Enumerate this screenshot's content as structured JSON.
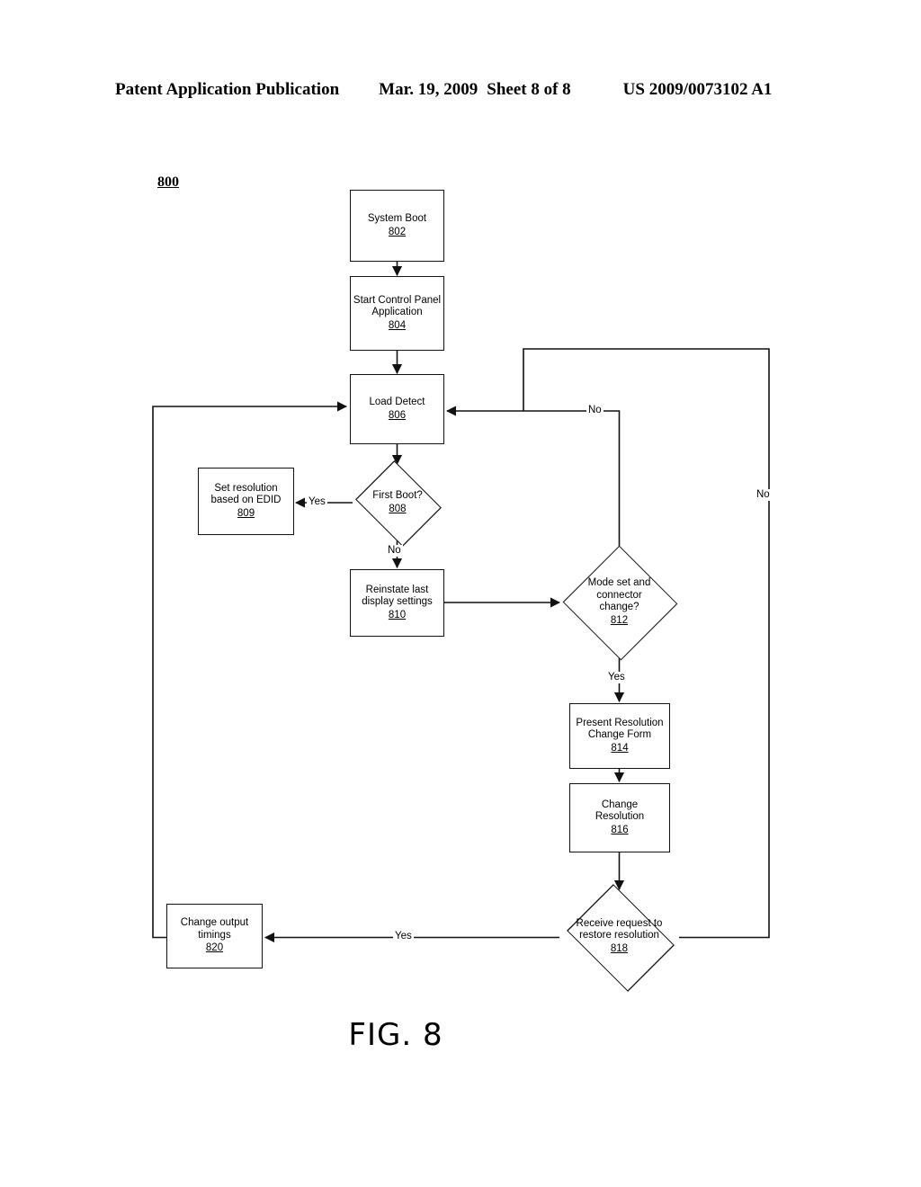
{
  "header": {
    "publication": "Patent Application Publication",
    "date": "Mar. 19, 2009",
    "sheet": "Sheet 8 of 8",
    "number": "US 2009/0073102 A1"
  },
  "figure": {
    "caption": "FIG. 8",
    "diagram_reference": "800"
  },
  "flowchart": {
    "nodes": [
      {
        "id": "802",
        "shape": "process",
        "text": "System Boot",
        "number": "802"
      },
      {
        "id": "804",
        "shape": "process",
        "text": "Start Control Panel\nApplication",
        "number": "804"
      },
      {
        "id": "806",
        "shape": "process",
        "text": "Load Detect",
        "number": "806"
      },
      {
        "id": "808",
        "shape": "decision",
        "text": "First Boot?",
        "number": "808"
      },
      {
        "id": "809",
        "shape": "process",
        "text": "Set resolution\nbased on EDID",
        "number": "809"
      },
      {
        "id": "810",
        "shape": "process",
        "text": "Reinstate last\ndisplay settings",
        "number": "810"
      },
      {
        "id": "812",
        "shape": "decision",
        "text": "Mode set and\nconnector\nchange?",
        "number": "812"
      },
      {
        "id": "814",
        "shape": "process",
        "text": "Present Resolution\nChange Form",
        "number": "814"
      },
      {
        "id": "816",
        "shape": "process",
        "text": "Change\nResolution",
        "number": "816"
      },
      {
        "id": "818",
        "shape": "decision",
        "text": "Receive request to\nrestore resolution",
        "number": "818"
      },
      {
        "id": "820",
        "shape": "process",
        "text": "Change output\ntimings",
        "number": "820"
      }
    ],
    "edges": [
      {
        "id": "e-802-804",
        "from": "802",
        "to": "804",
        "label": ""
      },
      {
        "id": "e-804-806",
        "from": "804",
        "to": "806",
        "label": ""
      },
      {
        "id": "e-806-808",
        "from": "806",
        "to": "808",
        "label": ""
      },
      {
        "id": "e-808-809",
        "from": "808",
        "to": "809",
        "label": "Yes"
      },
      {
        "id": "e-808-810",
        "from": "808",
        "to": "810",
        "label": "No"
      },
      {
        "id": "e-810-812",
        "from": "810",
        "to": "812",
        "label": ""
      },
      {
        "id": "e-812-806",
        "from": "812",
        "to": "806",
        "label": "No"
      },
      {
        "id": "e-812-814",
        "from": "812",
        "to": "814",
        "label": "Yes"
      },
      {
        "id": "e-814-816",
        "from": "814",
        "to": "816",
        "label": ""
      },
      {
        "id": "e-816-818",
        "from": "816",
        "to": "818",
        "label": ""
      },
      {
        "id": "e-818-820",
        "from": "818",
        "to": "820",
        "label": "Yes"
      },
      {
        "id": "e-818-806",
        "from": "818",
        "to": "806",
        "label": "No"
      },
      {
        "id": "e-820-806",
        "from": "820",
        "to": "806",
        "label": ""
      }
    ],
    "edge_labels": {
      "yes_808": "Yes",
      "no_808": "No",
      "no_812": "No",
      "yes_812": "Yes",
      "yes_818": "Yes",
      "no_818": "No"
    }
  },
  "colors": {
    "ink": "#111111",
    "paper": "#ffffff"
  }
}
